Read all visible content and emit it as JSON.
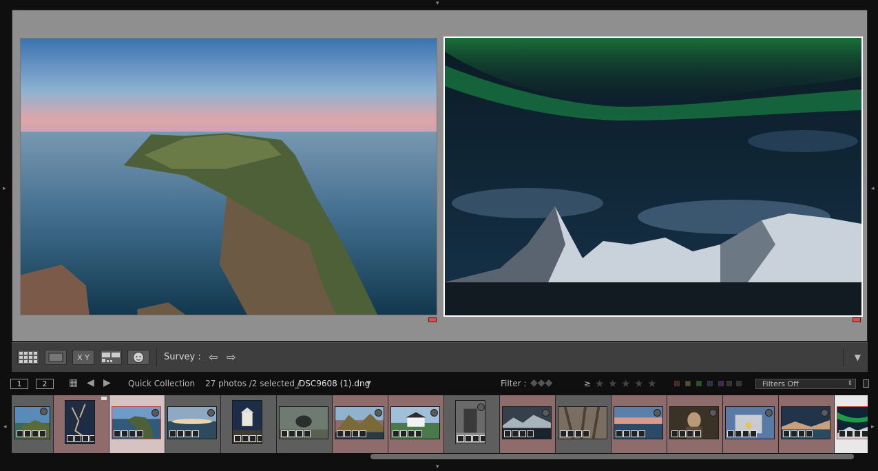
{
  "toolbar": {
    "survey_label": "Survey :",
    "xy_label": "X Y",
    "prev_icon": "arrow-left-icon",
    "next_icon": "arrow-right-icon"
  },
  "filmstrip_header": {
    "screen1": "1",
    "screen2": "2",
    "source": "Quick Collection",
    "status": "27 photos /2 selected /",
    "filename": "_DSC9608 (1).dng",
    "filter_label": "Filter :",
    "rating_op": "≥",
    "filters_value": "Filters Off"
  },
  "colors": {
    "label_red": "#d94e4e",
    "selected_cell": "#d7c2c2",
    "panel_gray": "#8f8f8f"
  }
}
